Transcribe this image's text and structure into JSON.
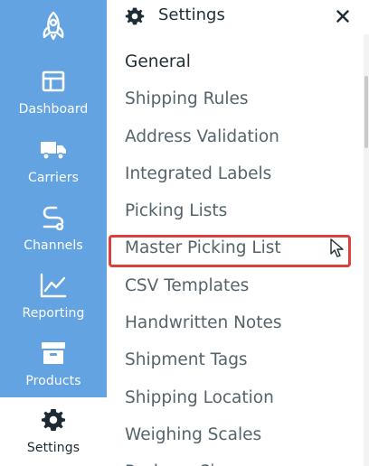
{
  "rail": {
    "logo_icon": "rocket-logo-icon",
    "items": [
      {
        "label": "Dashboard",
        "icon": "dashboard-icon"
      },
      {
        "label": "Carriers",
        "icon": "truck-icon"
      },
      {
        "label": "Channels",
        "icon": "channels-icon"
      },
      {
        "label": "Reporting",
        "icon": "chart-line-icon"
      },
      {
        "label": "Products",
        "icon": "box-icon"
      },
      {
        "label": "Settings",
        "icon": "gear-icon",
        "active": true
      }
    ]
  },
  "panel": {
    "title": "Settings",
    "title_icon": "gear-icon",
    "close_icon": "close-icon",
    "menu": [
      "General",
      "Shipping Rules",
      "Address Validation",
      "Integrated Labels",
      "Picking Lists",
      "Master Picking List",
      "CSV Templates",
      "Handwritten Notes",
      "Shipment Tags",
      "Shipping Location",
      "Weighing Scales",
      "Package Sizes"
    ],
    "highlighted_item": "Master Picking List"
  },
  "colors": {
    "rail_bg": "#63a3e2",
    "highlight_border": "#d9413f",
    "text_dark": "#1f2d36",
    "text_muted": "#55636c"
  }
}
